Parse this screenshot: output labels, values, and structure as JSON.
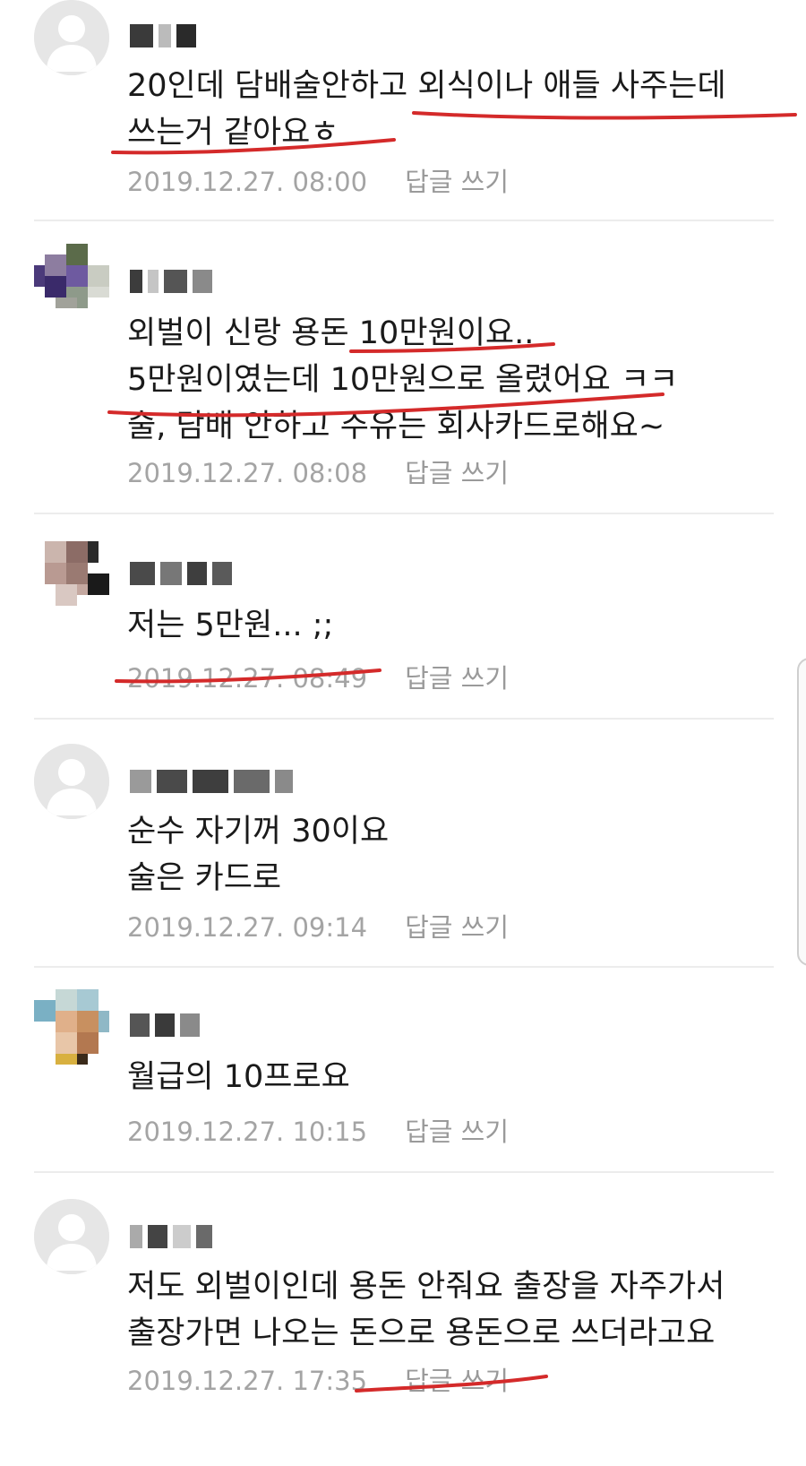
{
  "comments": [
    {
      "text": "20인데 담배술안하고 외식이나 애들 사주는데\n쓰는거 같아요ㅎ",
      "time": "2019.12.27. 08:00",
      "reply_label": "답글 쓰기"
    },
    {
      "text": "외벌이 신랑 용돈 10만원이요..\n5만원이였는데 10만원으로 올렸어요 ㅋㅋ\n술, 담배 안하고 주유는 회사카드로해요~",
      "time": "2019.12.27. 08:08",
      "reply_label": "답글 쓰기"
    },
    {
      "text": "저는 5만원... ;;",
      "time": "2019.12.27. 08:49",
      "reply_label": "답글 쓰기"
    },
    {
      "text": "순수 자기꺼 30이요\n술은 카드로",
      "time": "2019.12.27. 09:14",
      "reply_label": "답글 쓰기"
    },
    {
      "text": "월급의 10프로요",
      "time": "2019.12.27. 10:15",
      "reply_label": "답글 쓰기"
    },
    {
      "text": "저도 외벌이인데 용돈 안줘요 출장을 자주가서\n출장가면 나오는 돈으로 용돈으로 쓰더라고요",
      "time": "2019.12.27. 17:35",
      "reply_label": "답글 쓰기"
    }
  ],
  "colors": {
    "underline": "#d42a2a",
    "meta_text": "#a4a4a4",
    "divider": "#ececec"
  }
}
